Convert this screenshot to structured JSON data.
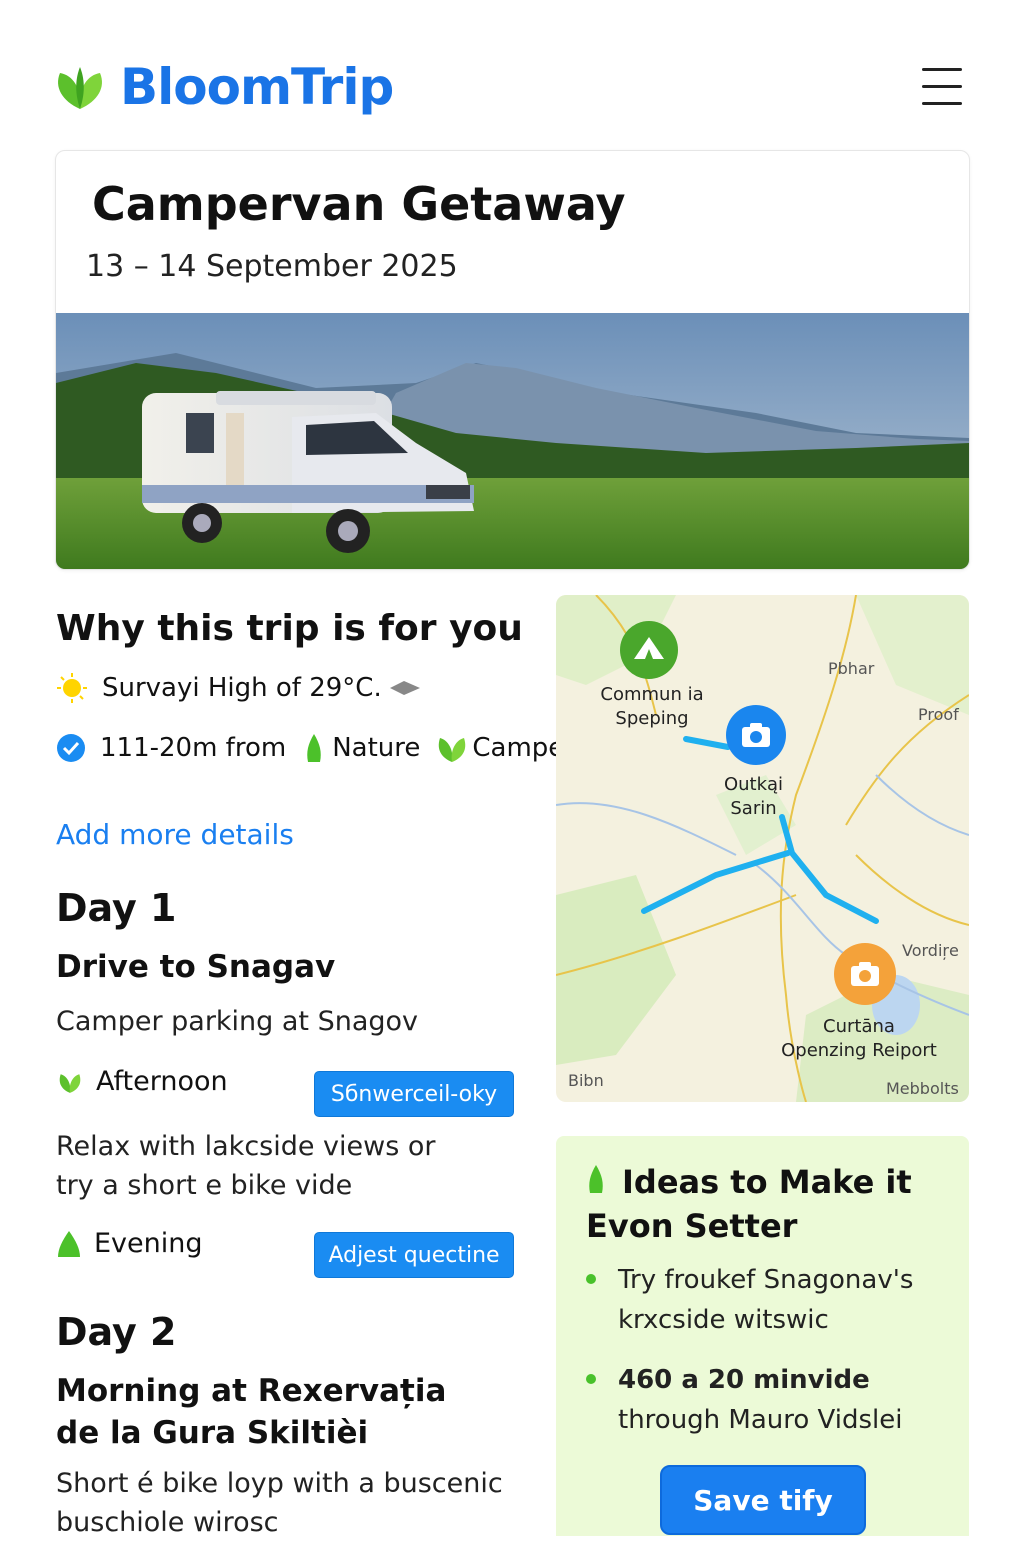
{
  "brand": {
    "name": "BloomTrip"
  },
  "trip": {
    "title": "Campervan Getaway",
    "dates": "13 – 14 September 2025"
  },
  "why": {
    "title": "Why this trip is for you",
    "weather": "Survayi High of 29°C.",
    "distance": "111-20m from",
    "tag_nature": "Nature",
    "tag_camper": "Camper",
    "add_more": "Add more details"
  },
  "day1": {
    "heading": "Day 1",
    "title": "Drive to Snagav",
    "subtitle": "Camper parking at Snagov",
    "afternoon_label": "Afternoon",
    "afternoon_button": "Sбnwerceil-oky",
    "afternoon_text_1": "Relax with lakcside views or",
    "afternoon_text_2": "try a short e bike vide",
    "evening_label": "Evening",
    "evening_button": "Adjest quectine"
  },
  "day2": {
    "heading": "Day 2",
    "title_1": "Morning at Rexervația",
    "title_2": "de la Gura Skiltièi",
    "text_1": "Short é bike loyp with a buscenic",
    "text_2": "buschiole wirosc"
  },
  "map": {
    "pin1_l1": "Commun ia",
    "pin1_l2": "Speping",
    "pin2_l1": "Outkąi",
    "pin2_l2": "Sarin",
    "pin3_l1": "Curtāna",
    "pin3_l2": "Openzing Reiport",
    "place_pbhar": "Pbhar",
    "place_proof": "Proof",
    "place_vordire": "Vordiŗe",
    "place_bibn": "Bibn",
    "place_mebbolts": "Mebbolts"
  },
  "ideas": {
    "title_1": "Ideas to Make it",
    "title_2": "Evon Setter",
    "item1_l1": "Try froukef Snagonav's",
    "item1_l2": "krxcside witswic",
    "item2_l1": "460 a 20 minvide",
    "item2_l2": "through Mauro Vidslei",
    "save_label": "Save tify"
  },
  "colors": {
    "brand": "#1a74e6",
    "accent_green": "#48c12a",
    "button_blue": "#1a7ff0",
    "ideas_bg": "#ecfad7"
  }
}
